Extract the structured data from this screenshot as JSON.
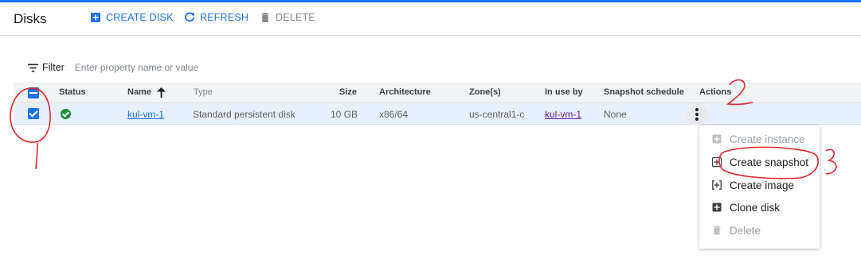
{
  "header": {
    "title": "Disks",
    "create_label": "CREATE DISK",
    "refresh_label": "REFRESH",
    "delete_label": "DELETE"
  },
  "filter": {
    "label": "Filter",
    "placeholder": "Enter property name or value"
  },
  "table": {
    "columns": [
      "Status",
      "Name",
      "Type",
      "Size",
      "Architecture",
      "Zone(s)",
      "In use by",
      "Snapshot schedule",
      "Actions"
    ],
    "sort_column": "Name",
    "sort_direction": "ascending",
    "rows": [
      {
        "selected": true,
        "status": "ok",
        "name": "kul-vm-1",
        "type": "Standard persistent disk",
        "size": "10 GB",
        "architecture": "x86/64",
        "zone": "us-central1-c",
        "in_use_by": "kul-vm-1",
        "snapshot_schedule": "None"
      }
    ]
  },
  "actions_menu": {
    "items": [
      {
        "label": "Create instance",
        "icon": "create-instance-icon",
        "enabled": false
      },
      {
        "label": "Create snapshot",
        "icon": "create-snapshot-icon",
        "enabled": true
      },
      {
        "label": "Create image",
        "icon": "create-image-icon",
        "enabled": true
      },
      {
        "label": "Clone disk",
        "icon": "clone-disk-icon",
        "enabled": true
      },
      {
        "label": "Delete",
        "icon": "trash-icon",
        "enabled": false
      }
    ]
  },
  "annotations": {
    "marks": [
      "1",
      "2",
      "3"
    ],
    "color": "#e3262b"
  },
  "colors": {
    "accent": "#1a73e8",
    "selected_row": "#e8f0fe",
    "status_ok": "#1e8e3e",
    "visited_link": "#681da8"
  }
}
